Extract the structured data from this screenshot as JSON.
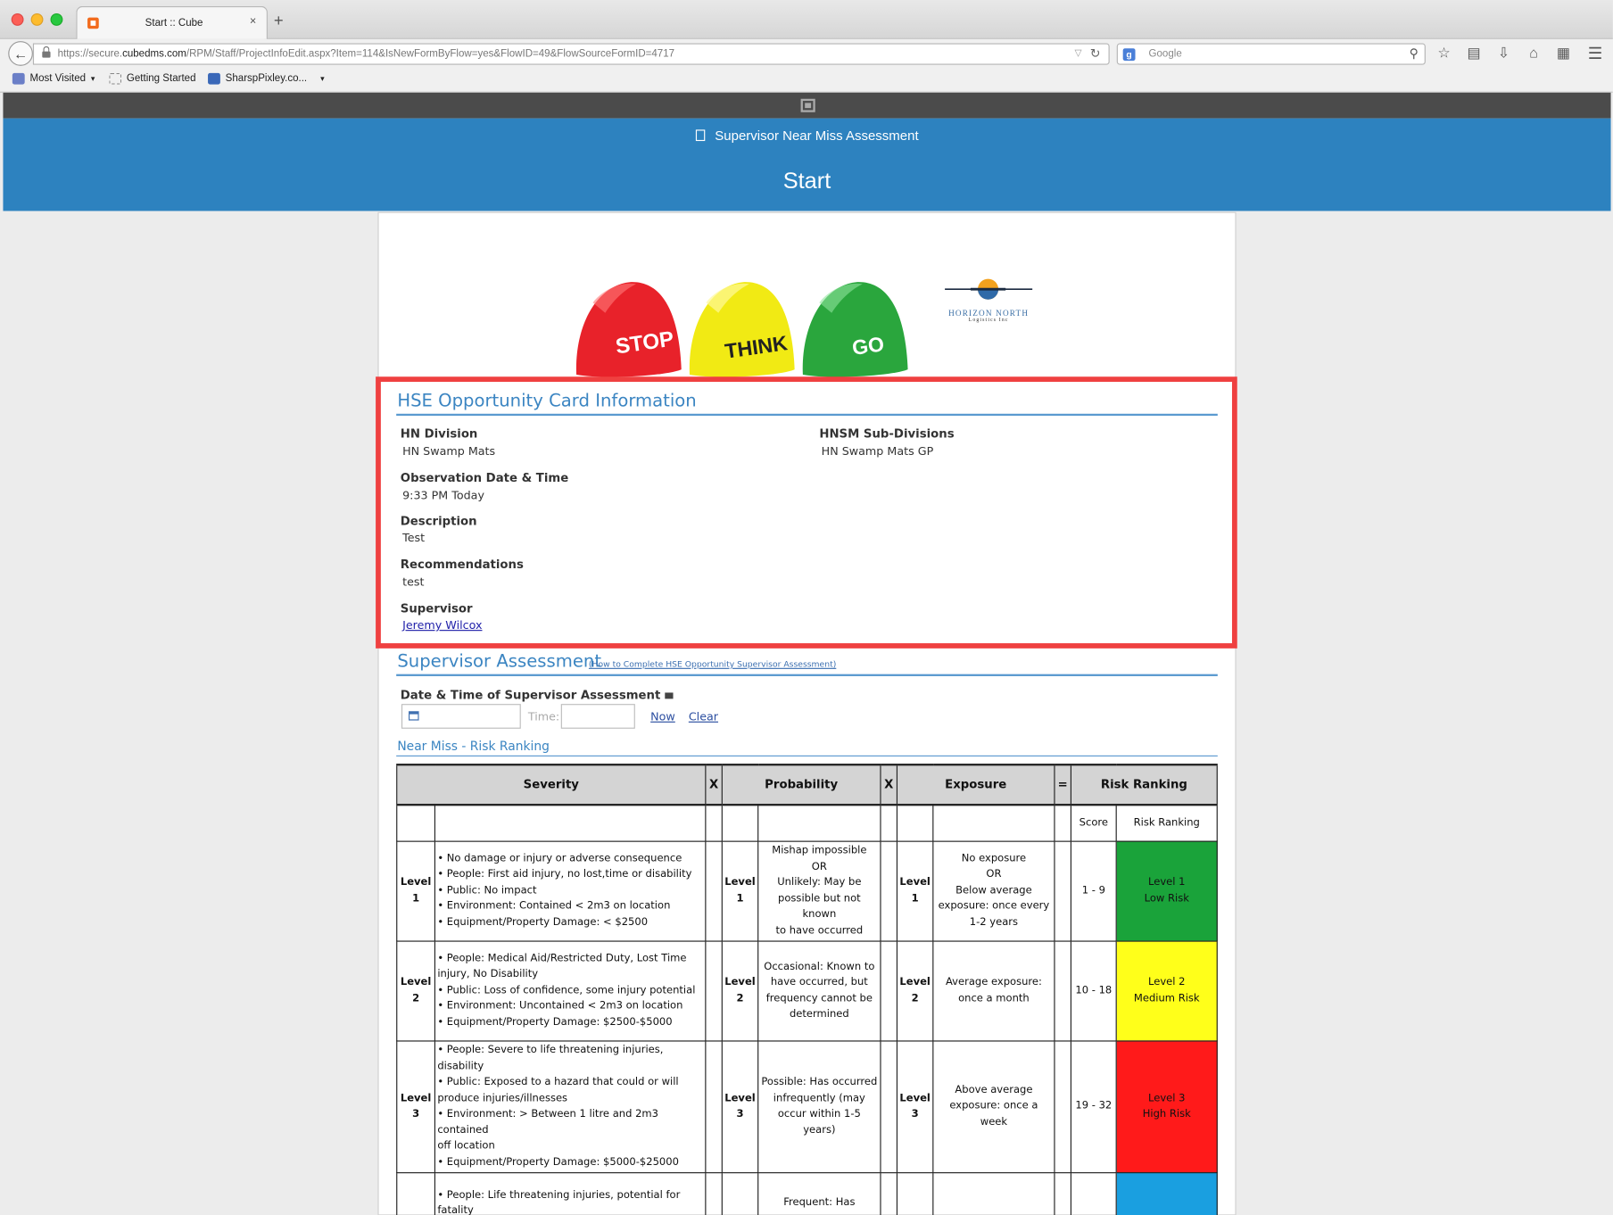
{
  "browser": {
    "tab_title": "Start :: Cube",
    "tab_close": "×",
    "new_tab": "+",
    "url_prefix": "https://secure.",
    "url_host": "cubedms.com",
    "url_path": "/RPM/Staff/ProjectInfoEdit.aspx?Item=114&IsNewFormByFlow=yes&FlowID=49&FlowSourceFormID=4717",
    "search_placeholder": "Google",
    "search_engine_icon": "g",
    "bookmarks": [
      "Most Visited",
      "Getting Started",
      "SharspPixley.co..."
    ]
  },
  "header": {
    "subtitle": "Supervisor Near Miss Assessment",
    "title": "Start"
  },
  "hats": [
    "STOP",
    "THINK",
    "GO"
  ],
  "logo": {
    "name": "HORIZON NORTH",
    "sub": "Logistics Inc"
  },
  "hse_card": {
    "title": "HSE Opportunity Card Information",
    "fields": {
      "division_label": "HN Division",
      "division_value": "HN Swamp Mats",
      "subdivision_label": "HNSM Sub-Divisions",
      "subdivision_value": "HN Swamp Mats GP",
      "obs_label": "Observation Date & Time",
      "obs_value": "9:33 PM Today",
      "desc_label": "Description",
      "desc_value": "Test",
      "rec_label": "Recommendations",
      "rec_value": "test",
      "sup_label": "Supervisor",
      "sup_value": "Jeremy Wilcox"
    }
  },
  "assessment": {
    "title": "Supervisor Assessment",
    "help_link": "(How to Complete HSE Opportunity Supervisor Assessment)",
    "datetime_label": "Date & Time of Supervisor Assessment",
    "time_placeholder": "Time:",
    "now_link": "Now",
    "clear_link": "Clear",
    "risk_subtitle": "Near Miss - Risk Ranking"
  },
  "risk_table": {
    "headers": {
      "severity": "Severity",
      "x1": "X",
      "probability": "Probability",
      "x2": "X",
      "exposure": "Exposure",
      "eq": "=",
      "ranking": "Risk Ranking"
    },
    "sub_headers": {
      "score": "Score",
      "ranking": "Risk Ranking"
    },
    "rows": [
      {
        "sev_level": "Level 1",
        "severity": [
          "• No damage or injury or adverse consequence",
          "• People: First aid injury, no lost,time or disability",
          "• Public: No impact",
          "• Environment: Contained < 2m3 on location",
          "• Equipment/Property Damage: < $2500"
        ],
        "prob_level": "Level 1",
        "probability": [
          "Mishap impossible",
          "OR",
          "Unlikely: May be",
          "possible but not known",
          "to have occurred"
        ],
        "exp_level": "Level 1",
        "exposure": [
          "No exposure",
          "OR",
          "Below average",
          "exposure: once every",
          "1-2 years"
        ],
        "score": "1 - 9",
        "rank": [
          "Level 1",
          "Low Risk"
        ],
        "color": "#1aa33a"
      },
      {
        "sev_level": "Level 2",
        "severity": [
          "• People: Medical Aid/Restricted Duty, Lost Time",
          "injury, No Disability",
          "• Public: Loss of confidence, some injury potential",
          "• Environment: Uncontained < 2m3 on location",
          "• Equipment/Property Damage: $2500-$5000"
        ],
        "prob_level": "Level 2",
        "probability": [
          "Occasional: Known to",
          "have occurred, but",
          "frequency cannot be",
          "determined"
        ],
        "exp_level": "Level 2",
        "exposure": [
          "Average exposure:",
          "once a month"
        ],
        "score": "10 - 18",
        "rank": [
          "Level 2",
          "Medium Risk"
        ],
        "color": "#ffff1a"
      },
      {
        "sev_level": "Level 3",
        "severity": [
          "• People: Severe to life threatening injuries,",
          "disability",
          "• Public: Exposed to a hazard that could or will",
          "produce injuries/illnesses",
          "• Environment: > Between 1 litre and 2m3 contained",
          "off location",
          "• Equipment/Property Damage: $5000-$25000"
        ],
        "prob_level": "Level 3",
        "probability": [
          "Possible: Has occurred",
          "infrequently (may",
          "occur within 1-5 years)"
        ],
        "exp_level": "Level 3",
        "exposure": [
          "Above average",
          "exposure: once a week"
        ],
        "score": "19 - 32",
        "rank": [
          "Level 3",
          "High Risk"
        ],
        "color": "#ff1a1a"
      },
      {
        "sev_level": "",
        "severity": [
          "• People: Life threatening injuries, potential for",
          "fatality"
        ],
        "prob_level": "",
        "probability": [
          "",
          "Frequent: Has"
        ],
        "exp_level": "",
        "exposure": [
          ""
        ],
        "score": "",
        "rank": [
          ""
        ],
        "color": "#1a9fe0"
      }
    ]
  },
  "colors": {
    "header_blue": "#2d82bf",
    "highlight_red": "#ef4040",
    "section_blue": "#3b85c2"
  }
}
